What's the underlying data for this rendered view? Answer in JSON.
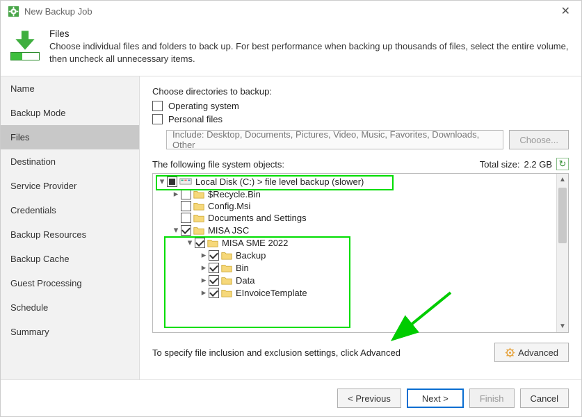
{
  "titlebar": {
    "title": "New Backup Job"
  },
  "header": {
    "title": "Files",
    "subtitle": "Choose individual files and folders to back up. For best performance when backing up thousands of files, select the entire volume, then uncheck all unnecessary items."
  },
  "sidebar": {
    "items": [
      {
        "label": "Name",
        "active": false
      },
      {
        "label": "Backup Mode",
        "active": false
      },
      {
        "label": "Files",
        "active": true
      },
      {
        "label": "Destination",
        "active": false
      },
      {
        "label": "Service Provider",
        "active": false
      },
      {
        "label": "Credentials",
        "active": false
      },
      {
        "label": "Backup Resources",
        "active": false
      },
      {
        "label": "Backup Cache",
        "active": false
      },
      {
        "label": "Guest Processing",
        "active": false
      },
      {
        "label": "Schedule",
        "active": false
      },
      {
        "label": "Summary",
        "active": false
      }
    ]
  },
  "main": {
    "choose_label": "Choose directories to backup:",
    "os_label": "Operating system",
    "pf_label": "Personal files",
    "include_placeholder": "Include: Desktop, Documents, Pictures, Video, Music, Favorites, Downloads, Other",
    "choose_btn": "Choose...",
    "objects_label": "The following file system objects:",
    "total_size_label": "Total size:",
    "total_size_value": "2.2 GB",
    "advanced_hint": "To specify file inclusion and exclusion settings, click Advanced",
    "advanced_btn": "Advanced"
  },
  "tree": {
    "root": {
      "label": "Local Disk (C:) > file level backup (slower)",
      "state": "indeterminate",
      "expanded": true
    },
    "children": [
      {
        "label": "$Recycle.Bin",
        "state": "unchecked",
        "expanded": false,
        "depth": 1,
        "has_children": true
      },
      {
        "label": "Config.Msi",
        "state": "unchecked",
        "expanded": false,
        "depth": 1,
        "has_children": false
      },
      {
        "label": "Documents and Settings",
        "state": "unchecked",
        "expanded": false,
        "depth": 1,
        "has_children": false
      },
      {
        "label": "MISA JSC",
        "state": "checked",
        "expanded": true,
        "depth": 1,
        "has_children": true
      },
      {
        "label": "MISA SME 2022",
        "state": "checked",
        "expanded": true,
        "depth": 2,
        "has_children": true
      },
      {
        "label": "Backup",
        "state": "checked",
        "expanded": false,
        "depth": 3,
        "has_children": true
      },
      {
        "label": "Bin",
        "state": "checked",
        "expanded": false,
        "depth": 3,
        "has_children": true
      },
      {
        "label": "Data",
        "state": "checked",
        "expanded": false,
        "depth": 3,
        "has_children": true
      },
      {
        "label": "EInvoiceTemplate",
        "state": "checked",
        "expanded": false,
        "depth": 3,
        "has_children": true
      }
    ]
  },
  "footer": {
    "previous": "< Previous",
    "next": "Next >",
    "finish": "Finish",
    "cancel": "Cancel"
  }
}
